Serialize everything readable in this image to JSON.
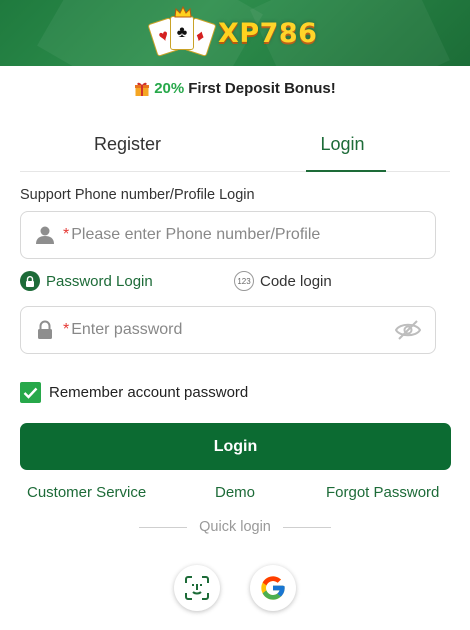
{
  "header": {
    "logo_text": "XP786",
    "card_suits": [
      "♥",
      "♣",
      "♦"
    ]
  },
  "bonus": {
    "percent": "20%",
    "text": "First Deposit Bonus!"
  },
  "tabs": [
    {
      "label": "Register",
      "active": false
    },
    {
      "label": "Login",
      "active": true
    }
  ],
  "form": {
    "support_label": "Support Phone number/Profile Login",
    "phone_placeholder": "Please enter Phone number/Profile",
    "password_placeholder": "Enter password",
    "required_mark": "*",
    "password_login_label": "Password Login",
    "code_login_label": "Code login",
    "code_icon_text": "123",
    "remember_label": "Remember account password",
    "remember_checked": true,
    "login_button": "Login"
  },
  "links": {
    "customer_service": "Customer Service",
    "demo": "Demo",
    "forgot_password": "Forgot Password"
  },
  "quick_login": {
    "label": "Quick login",
    "methods": [
      "face-id-icon",
      "google-icon"
    ]
  },
  "colors": {
    "brand_green": "#1d6b38",
    "button_green": "#0c6b32",
    "accent_green": "#27a84a",
    "logo_yellow": "#ffd21f",
    "required_red": "#e53935"
  }
}
